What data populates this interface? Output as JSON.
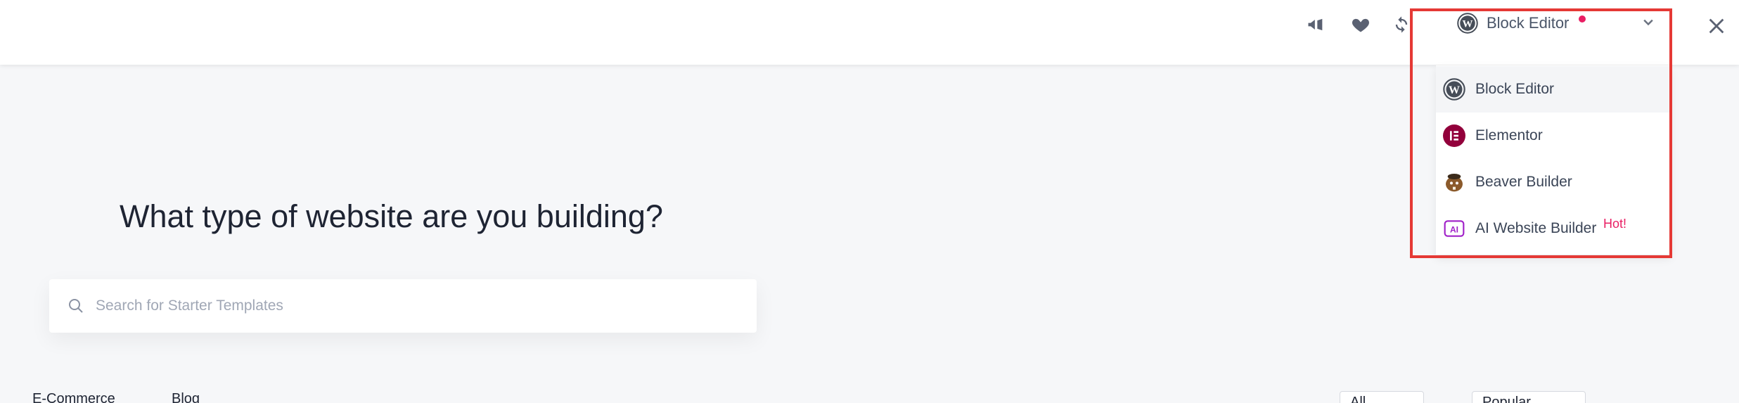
{
  "toolbar": {
    "icons": [
      "megaphone-icon",
      "heart-icon",
      "sync-icon",
      "close-icon"
    ]
  },
  "builder_selector": {
    "current_label": "Block Editor",
    "items": [
      {
        "label": "Block Editor",
        "icon": "wordpress-icon"
      },
      {
        "label": "Elementor",
        "icon": "elementor-icon"
      },
      {
        "label": "Beaver Builder",
        "icon": "beaver-icon"
      },
      {
        "label": "AI Website Builder",
        "icon": "ai-icon",
        "badge": "Hot!"
      }
    ]
  },
  "main": {
    "title": "What type of website are you building?",
    "search_placeholder": "Search for Starter Templates"
  },
  "categories": {
    "items": [
      "E-Commerce",
      "Blog"
    ],
    "filter_type": "All",
    "sort_label": "Popular"
  },
  "colors": {
    "accent": "#e91e63",
    "highlight": "#e53935",
    "elementor": "#92003b"
  }
}
